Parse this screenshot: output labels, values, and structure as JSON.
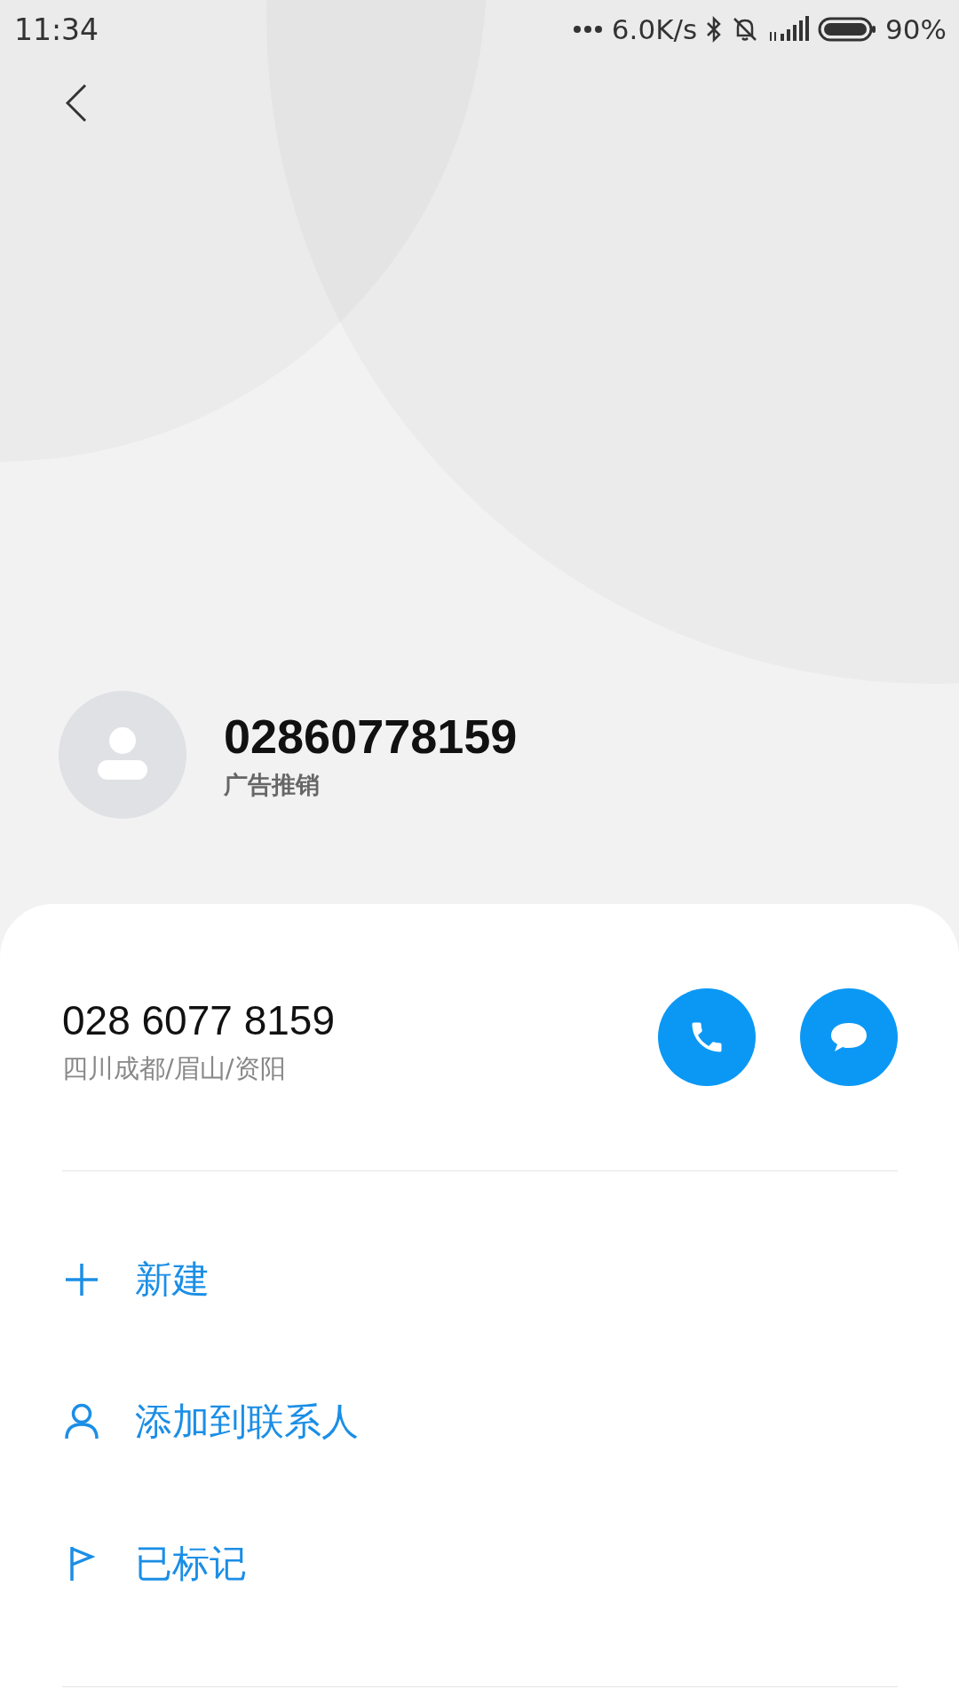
{
  "status_bar": {
    "time": "11:34",
    "net_speed": "6.0K/s",
    "battery": "90%"
  },
  "caller": {
    "number": "02860778159",
    "tag": "广告推销"
  },
  "detail": {
    "number": "028 6077 8159",
    "location": "四川成都/眉山/资阳"
  },
  "actions": [
    {
      "kind": "new",
      "label": "新建"
    },
    {
      "kind": "contact",
      "label": "添加到联系人"
    },
    {
      "kind": "flag",
      "label": "已标记"
    }
  ]
}
